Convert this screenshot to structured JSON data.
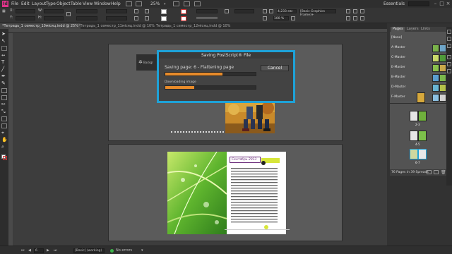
{
  "menubar": {
    "app_logo": "Id",
    "items": [
      "File",
      "Edit",
      "Layout",
      "Type",
      "Object",
      "Table",
      "View",
      "Window",
      "Help"
    ],
    "zoom": "25%",
    "workspace": "Essentials"
  },
  "controlbar": {
    "x_value": "",
    "stroke_value": "",
    "percent_value": "100 %",
    "mm_value": "4,233 мм",
    "style_value": "[Basic Graphics Frame]+"
  },
  "tabs": [
    "*Тетрадь_1 семестр_10мiсяц.indd @ 25%",
    "*Тетрадь_1 семестр_11мiсяц.indd @ 10%",
    "Тетрадь_1 семестр_12мiсяц.indd @ 10%"
  ],
  "dialog": {
    "title": "Saving PostScript® File",
    "saving_text": "Saving page: 6 - Flattening page",
    "progress_main": 0.63,
    "cancel_label": "Cancel",
    "download_text": "Downloading image",
    "progress_download": 0.32
  },
  "background_panel": {
    "label": "Backgr"
  },
  "page_header": {
    "title": "Сентябрь 2013"
  },
  "pages_panel": {
    "tabs": [
      "Pages",
      "Layers",
      "Links"
    ],
    "masters": [
      "[None]",
      "A-Master",
      "C-Master",
      "E-Master",
      "B-Master",
      "D-Master",
      "F-Master"
    ],
    "spread_labels": [
      "2-3",
      "4-5",
      "6-7"
    ],
    "footer": "76 Pages in 39 Spreads"
  },
  "statusbar": {
    "page_number": "6",
    "style": "[Basic] (working)",
    "errors": "No errors"
  },
  "colors": {
    "accent": "#1ea2d8",
    "progress": "#e88b2a",
    "logo": "#e0338b"
  }
}
